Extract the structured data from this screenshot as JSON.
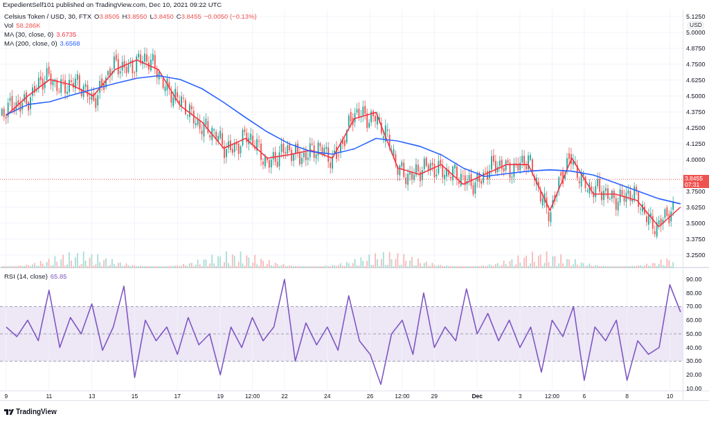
{
  "header": "ExpedientSelf101 published on TradingView.com, Dec 10, 2021 09:22 UTC",
  "legend": {
    "symbol": "Celsius Token / USD, 30, FTX",
    "ohlc": [
      {
        "label": "O",
        "value": "3.8505"
      },
      {
        "label": "H",
        "value": "3.8550"
      },
      {
        "label": "L",
        "value": "3.8450"
      },
      {
        "label": "C",
        "value": "3.8455"
      }
    ],
    "change": "−0.0050 (−0.13%)"
  },
  "volume": {
    "label": "Vol",
    "value": "58.286K"
  },
  "price_chart": {
    "axis_unit": "USD",
    "last_price": {
      "value": "3.8455",
      "countdown": "07:31"
    },
    "readouts": [
      "3.6735",
      "3.6568"
    ],
    "chart_data": {
      "type": "line",
      "grid": true,
      "categories": [
        null,
        null,
        null,
        null,
        null,
        null,
        null,
        null,
        null,
        null,
        null,
        null,
        null,
        null,
        null,
        null,
        null,
        null,
        null,
        null,
        null,
        null,
        null,
        null,
        null,
        null,
        null,
        null,
        null,
        null,
        null,
        null
      ],
      "ylim": [
        3.146,
        5.179
      ],
      "yticks": [
        {
          "value": 3.25,
          "label": "3.2500"
        },
        {
          "value": 3.375,
          "label": "3.3750"
        },
        {
          "value": 3.5,
          "label": "3.5000"
        },
        {
          "value": 3.625,
          "label": "3.6250"
        },
        {
          "value": 3.75,
          "label": "3.7500"
        },
        {
          "value": 4.0,
          "label": "4.0000"
        },
        {
          "value": 4.125,
          "label": "4.1250"
        },
        {
          "value": 4.25,
          "label": "4.2500"
        },
        {
          "value": 4.375,
          "label": "4.3750"
        },
        {
          "value": 4.5,
          "label": "4.5000"
        },
        {
          "value": 4.625,
          "label": "4.6250"
        },
        {
          "value": 4.75,
          "label": "4.7500"
        },
        {
          "value": 4.875,
          "label": "4.8750"
        },
        {
          "value": 5.0,
          "label": "5.0000"
        },
        {
          "value": 5.125,
          "label": "5.1250"
        }
      ],
      "series": [
        {
          "name": "MA (30, close, 0)",
          "color": "#f23645",
          "values": [
            4.347,
            4.501,
            4.63,
            4.588,
            4.501,
            4.707,
            4.784,
            4.707,
            4.424,
            4.295,
            4.089,
            4.167,
            4.012,
            4.038,
            4.074,
            4.012,
            4.321,
            4.372,
            3.935,
            3.884,
            3.961,
            3.807,
            3.884,
            3.961,
            3.961,
            3.601,
            4.012,
            3.729,
            3.729,
            3.678,
            3.472,
            3.627
          ]
        },
        {
          "name": "MA (200, close, 0)",
          "color": "#2962ff",
          "values": [
            4.352,
            4.434,
            4.455,
            4.506,
            4.552,
            4.599,
            4.64,
            4.66,
            4.63,
            4.558,
            4.45,
            4.331,
            4.218,
            4.125,
            4.064,
            4.043,
            4.084,
            4.167,
            4.146,
            4.105,
            4.038,
            3.935,
            3.868,
            3.889,
            3.909,
            3.92,
            3.909,
            3.879,
            3.817,
            3.755,
            3.693,
            3.652
          ]
        }
      ]
    }
  },
  "rsi": {
    "readout": "65.85",
    "chart_data": {
      "type": "line",
      "categories": [
        "9",
        null,
        null,
        null,
        "11",
        null,
        null,
        null,
        "13",
        null,
        null,
        null,
        "15",
        null,
        null,
        null,
        "17",
        null,
        null,
        null,
        "19",
        null,
        null,
        "12:00",
        null,
        null,
        "22",
        null,
        null,
        null,
        "24",
        null,
        null,
        null,
        "26",
        null,
        null,
        "12:00",
        null,
        null,
        "29",
        null,
        null,
        null,
        "Dec",
        null,
        null,
        null,
        "3",
        null,
        null,
        "12:00",
        null,
        null,
        "6",
        null,
        null,
        null,
        "8",
        null,
        null,
        null,
        "10",
        null
      ],
      "grid": true,
      "ylim": [
        7.97,
        98.1
      ],
      "yticks": [
        {
          "value": 10,
          "label": "10.00"
        },
        {
          "value": 20,
          "label": "20.00"
        },
        {
          "value": 30,
          "label": "30.00"
        },
        {
          "value": 40,
          "label": "40.00"
        },
        {
          "value": 50,
          "label": "50.00"
        },
        {
          "value": 60,
          "label": "60.00"
        },
        {
          "value": 70,
          "label": "70.00"
        },
        {
          "value": 80,
          "label": "80.00"
        },
        {
          "value": 90,
          "label": "90.00"
        }
      ],
      "series": [
        {
          "name": "RSI (14, close)",
          "color": "#7e57c2",
          "values": [
            55,
            48,
            60,
            45,
            82,
            40,
            62,
            50,
            72,
            38,
            55,
            85,
            18,
            60,
            45,
            55,
            35,
            62,
            42,
            50,
            20,
            55,
            40,
            62,
            45,
            55,
            90,
            30,
            58,
            42,
            55,
            38,
            78,
            45,
            35,
            13,
            50,
            60,
            35,
            80,
            40,
            55,
            45,
            83,
            50,
            65,
            45,
            60,
            40,
            55,
            22,
            60,
            48,
            70,
            16,
            55,
            45,
            60,
            16,
            45,
            35,
            40,
            86,
            66
          ]
        }
      ]
    }
  },
  "footer_logo": "TradingView"
}
